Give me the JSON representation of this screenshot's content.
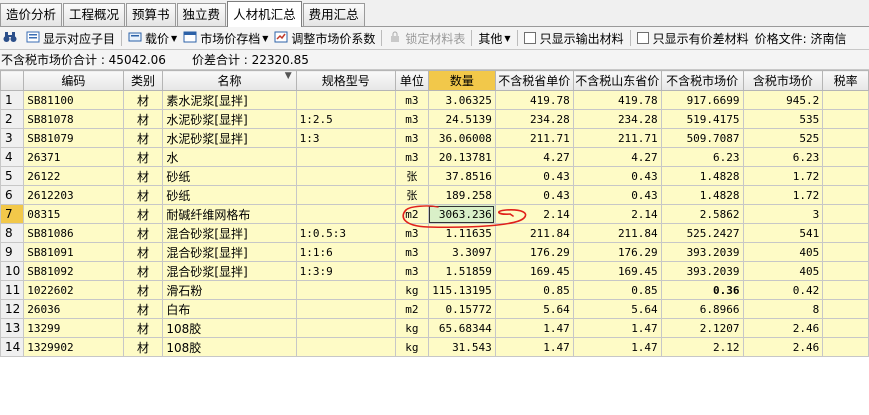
{
  "tabs": [
    {
      "label": "造价分析",
      "active": false
    },
    {
      "label": "工程概况",
      "active": false
    },
    {
      "label": "预算书",
      "active": false
    },
    {
      "label": "独立费",
      "active": false
    },
    {
      "label": "人材机汇总",
      "active": true
    },
    {
      "label": "费用汇总",
      "active": false
    }
  ],
  "toolbar": {
    "show_sub_items": "显示对应子目",
    "load_price": "载价",
    "market_price_archive": "市场价存档",
    "adjust_coefficient": "调整市场价系数",
    "lock_material_table": "锁定材料表",
    "other": "其他",
    "only_output_materials": "只显示输出材料",
    "only_price_diff_materials": "只显示有价差材料",
    "price_file": "价格文件: 济南信"
  },
  "summary": {
    "market_total": "不含税市场价合计 : 45042.06",
    "diff_total": "价差合计 : 22320.85"
  },
  "columns": [
    "编码",
    "类别",
    "名称",
    "规格型号",
    "单位",
    "数量",
    "不含税省单价",
    "不含税山东省价",
    "不含税市场价",
    "含税市场价",
    "税率"
  ],
  "rows": [
    {
      "no": "1",
      "code": "SB81100",
      "type": "材",
      "name": "素水泥浆[显拌]",
      "spec": "",
      "unit": "m3",
      "qty": "3.06325",
      "p1": "419.78",
      "p2": "419.78",
      "p3": "917.6699",
      "p4": "945.2"
    },
    {
      "no": "2",
      "code": "SB81078",
      "type": "材",
      "name": "水泥砂浆[显拌]",
      "spec": "1:2.5",
      "unit": "m3",
      "qty": "24.5139",
      "p1": "234.28",
      "p2": "234.28",
      "p3": "519.4175",
      "p4": "535"
    },
    {
      "no": "3",
      "code": "SB81079",
      "type": "材",
      "name": "水泥砂浆[显拌]",
      "spec": "1:3",
      "unit": "m3",
      "qty": "36.06008",
      "p1": "211.71",
      "p2": "211.71",
      "p3": "509.7087",
      "p4": "525"
    },
    {
      "no": "4",
      "code": "26371",
      "type": "材",
      "name": "水",
      "spec": "",
      "unit": "m3",
      "qty": "20.13781",
      "p1": "4.27",
      "p2": "4.27",
      "p3": "6.23",
      "p4": "6.23"
    },
    {
      "no": "5",
      "code": "26122",
      "type": "材",
      "name": "砂纸",
      "spec": "",
      "unit": "张",
      "qty": "37.8516",
      "p1": "0.43",
      "p2": "0.43",
      "p3": "1.4828",
      "p4": "1.72"
    },
    {
      "no": "6",
      "code": "2612203",
      "type": "材",
      "name": "砂纸",
      "spec": "",
      "unit": "张",
      "qty": "189.258",
      "p1": "0.43",
      "p2": "0.43",
      "p3": "1.4828",
      "p4": "1.72"
    },
    {
      "no": "7",
      "code": "08315",
      "type": "材",
      "name": "耐碱纤维网格布",
      "spec": "",
      "unit": "m2",
      "qty": "3063.236",
      "p1": "2.14",
      "p2": "2.14",
      "p3": "2.5862",
      "p4": "3"
    },
    {
      "no": "8",
      "code": "SB81086",
      "type": "材",
      "name": "混合砂浆[显拌]",
      "spec": "1:0.5:3",
      "unit": "m3",
      "qty": "1.11635",
      "p1": "211.84",
      "p2": "211.84",
      "p3": "525.2427",
      "p4": "541"
    },
    {
      "no": "9",
      "code": "SB81091",
      "type": "材",
      "name": "混合砂浆[显拌]",
      "spec": "1:1:6",
      "unit": "m3",
      "qty": "3.3097",
      "p1": "176.29",
      "p2": "176.29",
      "p3": "393.2039",
      "p4": "405"
    },
    {
      "no": "10",
      "code": "SB81092",
      "type": "材",
      "name": "混合砂浆[显拌]",
      "spec": "1:3:9",
      "unit": "m3",
      "qty": "1.51859",
      "p1": "169.45",
      "p2": "169.45",
      "p3": "393.2039",
      "p4": "405"
    },
    {
      "no": "11",
      "code": "1022602",
      "type": "材",
      "name": "滑石粉",
      "spec": "",
      "unit": "kg",
      "qty": "115.13195",
      "p1": "0.85",
      "p2": "0.85",
      "p3": "0.36",
      "p4": "0.42"
    },
    {
      "no": "12",
      "code": "26036",
      "type": "材",
      "name": "白布",
      "spec": "",
      "unit": "m2",
      "qty": "0.15772",
      "p1": "5.64",
      "p2": "5.64",
      "p3": "6.8966",
      "p4": "8"
    },
    {
      "no": "13",
      "code": "13299",
      "type": "材",
      "name": "108胶",
      "spec": "",
      "unit": "kg",
      "qty": "65.68344",
      "p1": "1.47",
      "p2": "1.47",
      "p3": "2.1207",
      "p4": "2.46"
    },
    {
      "no": "14",
      "code": "1329902",
      "type": "材",
      "name": "108胶",
      "spec": "",
      "unit": "kg",
      "qty": "31.543",
      "p1": "1.47",
      "p2": "1.47",
      "p3": "2.12",
      "p4": "2.46"
    }
  ],
  "colors": {
    "highlight": "#f2c84a",
    "row_bg": "#fefbc6",
    "selected_cell": "#d9f0c8",
    "annotation": "#e0201a"
  }
}
